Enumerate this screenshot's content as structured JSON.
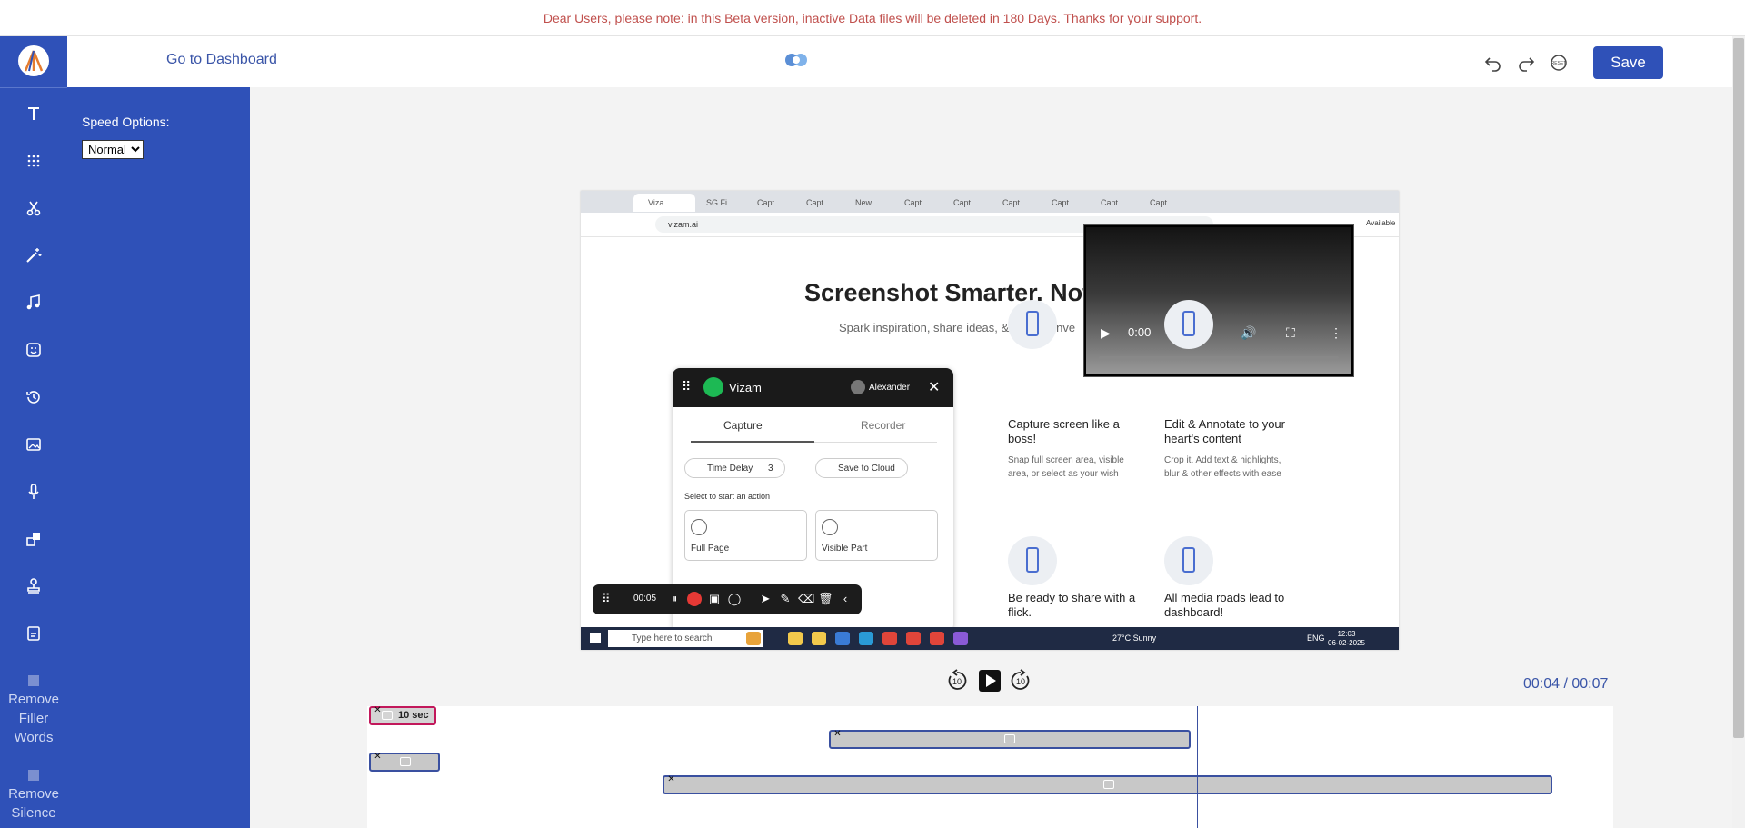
{
  "banner": {
    "text": "Dear Users, please note: in this Beta version, inactive Data files will be deleted in 180 Days. Thanks for your support."
  },
  "topbar": {
    "dashboard_link": "Go to Dashboard",
    "save_label": "Save",
    "reset_label": "RESET"
  },
  "rail": {
    "items": [
      {
        "icon": "text-icon"
      },
      {
        "icon": "blur-icon"
      },
      {
        "icon": "scissors-icon"
      },
      {
        "icon": "magic-wand-icon"
      },
      {
        "icon": "music-icon"
      },
      {
        "icon": "sticker-icon"
      },
      {
        "icon": "history-icon"
      },
      {
        "icon": "image-icon"
      },
      {
        "icon": "microphone-icon"
      },
      {
        "icon": "resize-icon"
      },
      {
        "icon": "stamp-icon"
      },
      {
        "icon": "export-icon"
      }
    ],
    "remove_filler": "Remove Filler Words",
    "remove_silence": "Remove Silence"
  },
  "side_panel": {
    "speed_label": "Speed Options:",
    "speed_value": "Normal"
  },
  "preview": {
    "tabs": [
      "Viza",
      "SG Fi",
      "Capt",
      "Capt",
      "New",
      "Capt",
      "Capt",
      "Capt",
      "Capt",
      "Capt",
      "Capt"
    ],
    "address": "vizam.ai",
    "headline": "Screenshot Smarter. Not",
    "subtitle": "Spark inspiration, share ideas, & ignite conve",
    "video_time": "0:00",
    "panel": {
      "title": "Vizam",
      "user": "Alexander",
      "tab_capture": "Capture",
      "tab_recorder": "Recorder",
      "time_delay": "Time Delay",
      "delay_value": "3",
      "save_cloud": "Save to Cloud",
      "hint": "Select to start an action",
      "full_page": "Full Page",
      "visible_part": "Visible Part"
    },
    "rec_time": "00:05",
    "features": [
      {
        "title": "Capture screen like a boss!",
        "desc": "Snap full screen area, visible area, or select as your wish"
      },
      {
        "title": "Edit & Annotate to your heart's content",
        "desc": "Crop it. Add text & highlights, blur & other effects with ease"
      },
      {
        "title": "Be ready to share with a flick.",
        "desc": ""
      },
      {
        "title": "All media roads lead to dashboard!",
        "desc": ""
      }
    ],
    "taskbar": {
      "search": "Type here to search",
      "weather": "27°C  Sunny",
      "lang": "ENG",
      "clock_time": "12:03",
      "clock_date": "06-02-2025",
      "available": "Available"
    }
  },
  "playback": {
    "time": "00:04 / 00:07",
    "skip_back": "10",
    "skip_fwd": "10"
  },
  "timeline": {
    "clip1_label": "10 sec"
  },
  "colors": {
    "brand": "#2f51b8",
    "banner_text": "#c0504d",
    "clip_border": "#3a50a0",
    "clip_pink": "#c2185b"
  }
}
